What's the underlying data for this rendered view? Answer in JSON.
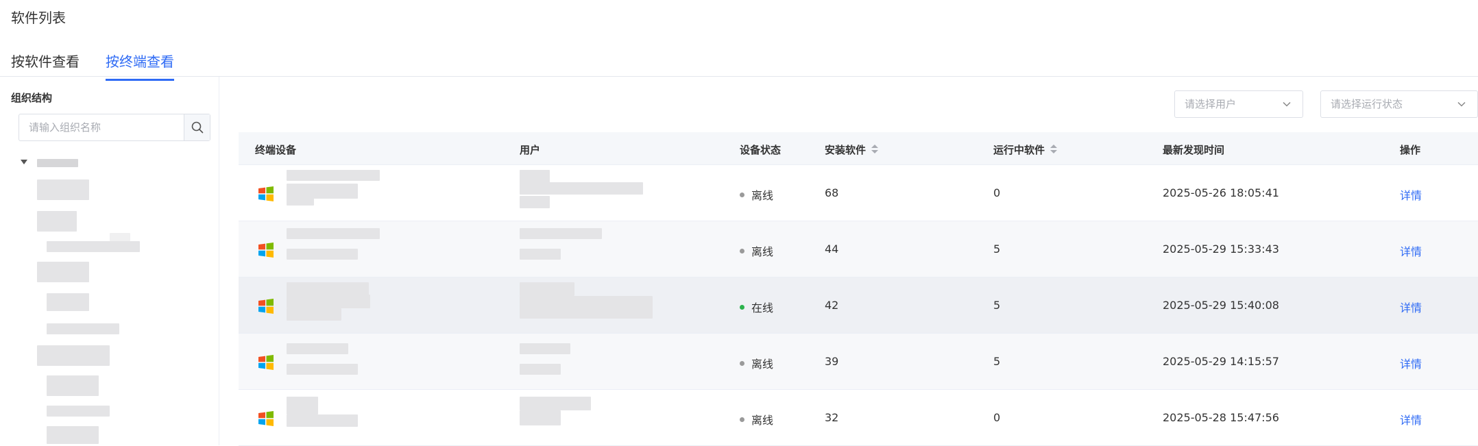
{
  "page": {
    "title": "软件列表"
  },
  "tabs": [
    {
      "label": "按软件查看",
      "active": false
    },
    {
      "label": "按终端查看",
      "active": true
    }
  ],
  "sidebar": {
    "title": "组织结构",
    "search_placeholder": "请输入组织名称"
  },
  "filters": {
    "user_placeholder": "请选择用户",
    "status_placeholder": "请选择运行状态"
  },
  "table": {
    "columns": [
      "终端设备",
      "用户",
      "设备状态",
      "安装软件",
      "运行中软件",
      "最新发现时间",
      "操作"
    ],
    "rows": [
      {
        "status": "离线",
        "status_color": "#9a9a9a",
        "installed": "68",
        "running": "0",
        "last_seen": "2025-05-26 18:05:41",
        "action": "详情"
      },
      {
        "status": "离线",
        "status_color": "#9a9a9a",
        "installed": "44",
        "running": "5",
        "last_seen": "2025-05-29 15:33:43",
        "action": "详情"
      },
      {
        "status": "在线",
        "status_color": "#2bb24c",
        "installed": "42",
        "running": "5",
        "last_seen": "2025-05-29 15:40:08",
        "action": "详情"
      },
      {
        "status": "离线",
        "status_color": "#9a9a9a",
        "installed": "39",
        "running": "5",
        "last_seen": "2025-05-29 14:15:57",
        "action": "详情"
      },
      {
        "status": "离线",
        "status_color": "#9a9a9a",
        "installed": "32",
        "running": "0",
        "last_seen": "2025-05-28 15:47:56",
        "action": "详情"
      }
    ]
  },
  "colors": {
    "accent": "#2f6bf5",
    "online": "#2bb24c",
    "offline": "#9a9a9a"
  },
  "icons": {
    "search": "search-icon",
    "dropdown": "chevron-down-icon",
    "os": "windows-icon",
    "sort": "sort-icon",
    "tree": "caret-down-icon"
  }
}
